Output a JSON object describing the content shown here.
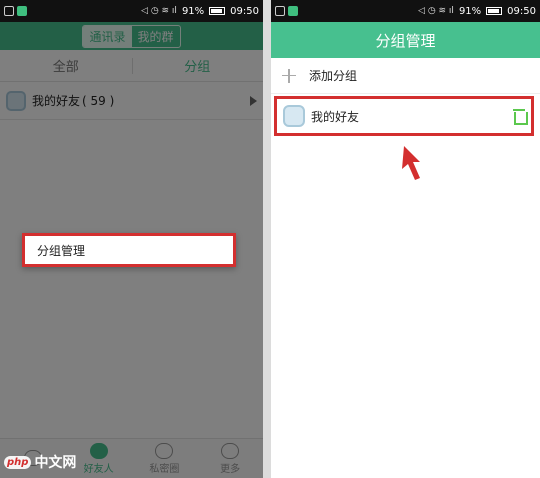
{
  "status_bar": {
    "battery": "91%",
    "time": "09:50"
  },
  "left_screen": {
    "header_tabs": [
      {
        "label": "通讯录",
        "active": true
      },
      {
        "label": "我的群",
        "active": false
      }
    ],
    "tabs": [
      {
        "label": "全部",
        "active": false
      },
      {
        "label": "分组",
        "active": true
      }
    ],
    "group": {
      "name": "我的好友",
      "count": "( 59 )"
    },
    "context_menu": {
      "item": "分组管理"
    },
    "bottom_nav": [
      {
        "label": "",
        "active": false
      },
      {
        "label": "好友人",
        "active": true
      },
      {
        "label": "私密圈",
        "active": false
      },
      {
        "label": "更多",
        "active": false
      }
    ]
  },
  "right_screen": {
    "title": "分组管理",
    "add_label": "添加分组",
    "group_label": "我的好友"
  },
  "watermark": {
    "logo": "php",
    "text": "中文网"
  },
  "colors": {
    "brand_green": "#47c08f",
    "highlight_red": "#d32f2f",
    "trash_green": "#5bc84d"
  }
}
